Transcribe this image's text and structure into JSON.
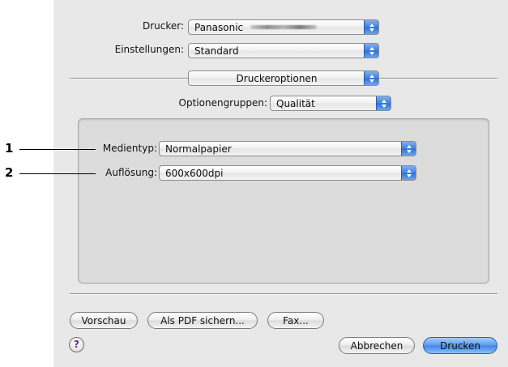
{
  "printer": {
    "label": "Drucker:",
    "value": "Panasonic"
  },
  "presets": {
    "label": "Einstellungen:",
    "value": "Standard"
  },
  "panel_menu": {
    "value": "Druckeroptionen"
  },
  "option_groups": {
    "label": "Optionengruppen:",
    "value": "Qualität"
  },
  "media_type": {
    "label": "Medientyp:",
    "value": "Normalpapier"
  },
  "resolution": {
    "label": "Auflösung:",
    "value": "600x600dpi"
  },
  "callouts": [
    "1",
    "2"
  ],
  "buttons": {
    "preview": "Vorschau",
    "save_pdf": "Als PDF sichern...",
    "fax": "Fax...",
    "cancel": "Abbrechen",
    "print": "Drucken",
    "help": "?"
  },
  "colors": {
    "accent": "#3f83e6",
    "dialog_bg": "#e8e8e8",
    "help_icon": "#5c2d91"
  },
  "icons": [
    "popup-stepper-icon",
    "help-icon"
  ]
}
